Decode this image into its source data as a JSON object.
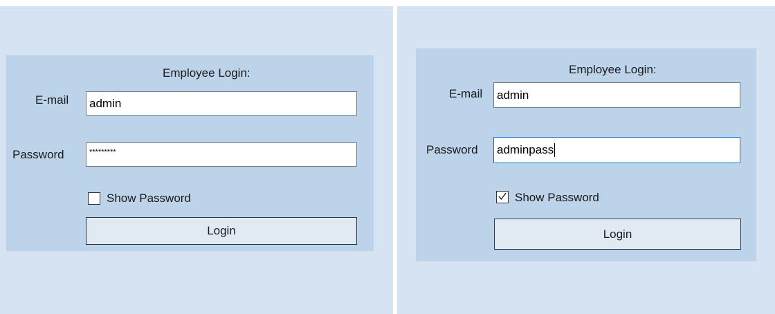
{
  "left_form": {
    "heading": "Employee Login:",
    "email_label": "E-mail",
    "email_value": "admin",
    "password_label": "Password",
    "password_value": "*********",
    "show_password_label": "Show Password",
    "show_password_checked": false,
    "login_label": "Login"
  },
  "right_form": {
    "heading": "Employee Login:",
    "email_label": "E-mail",
    "email_value": "admin",
    "password_label": "Password",
    "password_value": "adminpass",
    "show_password_label": "Show Password",
    "show_password_checked": true,
    "login_label": "Login"
  },
  "colors": {
    "background": "#d5e3f2",
    "panel": "#bcd3ea",
    "focus_border": "#0078d7"
  }
}
